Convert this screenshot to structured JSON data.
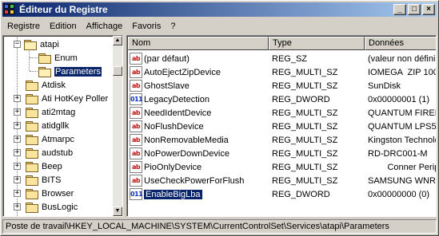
{
  "window": {
    "title": "Éditeur du Registre"
  },
  "titlebar_buttons": {
    "minimize": "_",
    "maximize": "□",
    "close": "×"
  },
  "menu": [
    "Registre",
    "Edition",
    "Affichage",
    "Favoris",
    "?"
  ],
  "tree": {
    "items": [
      {
        "label": "atapi",
        "expander": "−",
        "open": true
      },
      {
        "label": "Enum"
      },
      {
        "label": "Parameters",
        "selected": true
      },
      {
        "label": "Atdisk"
      },
      {
        "label": "Ati HotKey Poller",
        "expander": "+"
      },
      {
        "label": "ati2mtag",
        "expander": "+"
      },
      {
        "label": "atidgllk",
        "expander": "+"
      },
      {
        "label": "Atmarpc",
        "expander": "+"
      },
      {
        "label": "audstub",
        "expander": "+"
      },
      {
        "label": "Beep",
        "expander": "+"
      },
      {
        "label": "BITS",
        "expander": "+"
      },
      {
        "label": "Browser",
        "expander": "+"
      },
      {
        "label": "BusLogic",
        "expander": "+"
      }
    ]
  },
  "list": {
    "columns": [
      "Nom",
      "Type",
      "Données"
    ],
    "rows": [
      {
        "icon": "ab",
        "kind": "sz",
        "name": "(par défaut)",
        "type": "REG_SZ",
        "data": "(valeur non défini"
      },
      {
        "icon": "ab",
        "kind": "sz",
        "name": "AutoEjectZipDevice",
        "type": "REG_MULTI_SZ",
        "data": "IOMEGA  ZIP 100"
      },
      {
        "icon": "ab",
        "kind": "sz",
        "name": "GhostSlave",
        "type": "REG_MULTI_SZ",
        "data": "SunDisk"
      },
      {
        "icon": "011",
        "kind": "dw",
        "name": "LegacyDetection",
        "type": "REG_DWORD",
        "data": "0x00000001 (1)"
      },
      {
        "icon": "ab",
        "kind": "sz",
        "name": "NeedIdentDevice",
        "type": "REG_MULTI_SZ",
        "data": "QUANTUM FIREBA"
      },
      {
        "icon": "ab",
        "kind": "sz",
        "name": "NoFlushDevice",
        "type": "REG_MULTI_SZ",
        "data": "QUANTUM LPS52"
      },
      {
        "icon": "ab",
        "kind": "sz",
        "name": "NonRemovableMedia",
        "type": "REG_MULTI_SZ",
        "data": "Kingston Technolo"
      },
      {
        "icon": "ab",
        "kind": "sz",
        "name": "NoPowerDownDevice",
        "type": "REG_MULTI_SZ",
        "data": "RD-DRC001-M"
      },
      {
        "icon": "ab",
        "kind": "sz",
        "name": "PioOnlyDevice",
        "type": "REG_MULTI_SZ",
        "data": "        Conner Periphe"
      },
      {
        "icon": "ab",
        "kind": "sz",
        "name": "UseCheckPowerForFlush",
        "type": "REG_MULTI_SZ",
        "data": "SAMSUNG WNR-3"
      },
      {
        "icon": "011",
        "kind": "dw",
        "name": "EnableBigLba",
        "type": "REG_DWORD",
        "data": "0x00000000 (0)",
        "selected": true
      }
    ]
  },
  "statusbar": {
    "path": "Poste de travail\\HKEY_LOCAL_MACHINE\\SYSTEM\\CurrentControlSet\\Services\\atapi\\Parameters"
  },
  "colors": {
    "title_start": "#0a246a",
    "title_end": "#a6caf0",
    "selection": "#0a246a",
    "face": "#d4d0c8"
  }
}
